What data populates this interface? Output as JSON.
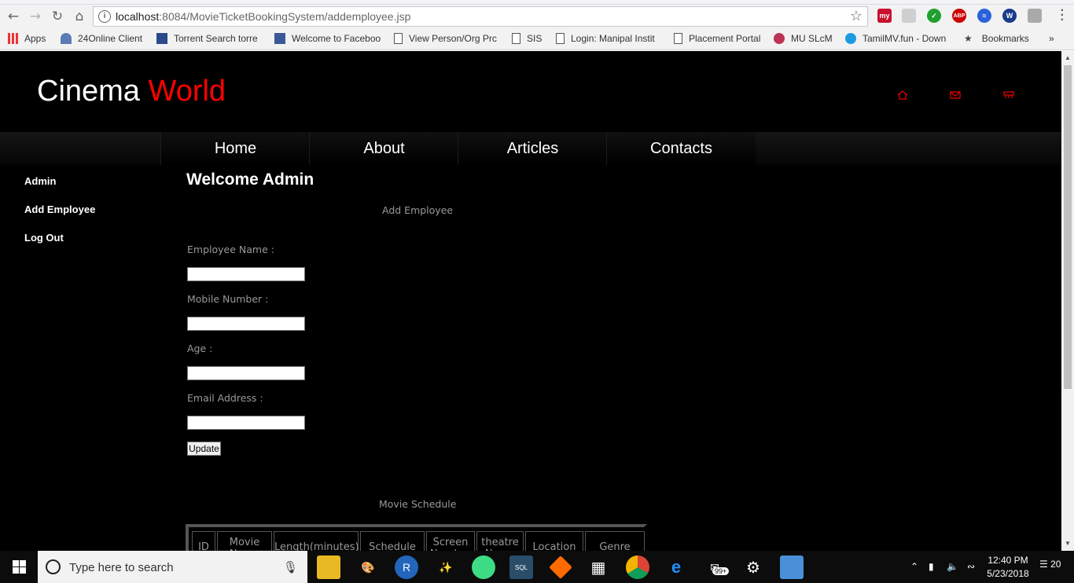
{
  "browser": {
    "url_host": "localhost",
    "url_path": ":8084/MovieTicketBookingSystem/addemployee.jsp",
    "bookmarks": [
      {
        "label": "Apps"
      },
      {
        "label": "24Online Client"
      },
      {
        "label": "Torrent Search torre"
      },
      {
        "label": "Welcome to Faceboo"
      },
      {
        "label": "View Person/Org Prc"
      },
      {
        "label": "SIS"
      },
      {
        "label": "Login: Manipal Instit"
      },
      {
        "label": "Placement Portal"
      },
      {
        "label": "MU SLcM"
      },
      {
        "label": "TamilMV.fun - Down"
      },
      {
        "label": "Bookmarks"
      }
    ],
    "more_bookmarks": "»",
    "ext_my": "my",
    "ext_abp": "ABP",
    "ext_w": "W"
  },
  "site": {
    "logo_part1": "Cinema",
    "logo_part2": "World",
    "nav": [
      "Home",
      "About",
      "Articles",
      "Contacts"
    ]
  },
  "sidebar": {
    "items": [
      "Admin",
      "Add Employee",
      "Log Out"
    ]
  },
  "main": {
    "welcome": "Welcome Admin",
    "form_title": "Add Employee",
    "fields": [
      {
        "label": "Employee Name :",
        "value": ""
      },
      {
        "label": "Mobile Number :",
        "value": ""
      },
      {
        "label": "Age :",
        "value": ""
      },
      {
        "label": "Email Address :",
        "value": ""
      }
    ],
    "submit_label": "Update",
    "schedule_title": "Movie Schedule",
    "table_headers": [
      "ID",
      "Movie Name",
      "Length(minutes)",
      "Schedule",
      "Screen Number",
      "theatre Name",
      "Location",
      "Genre"
    ]
  },
  "taskbar": {
    "search_placeholder": "Type here to search",
    "mail_badge": "99+",
    "time": "12:40 PM",
    "date": "5/23/2018",
    "notifications": "20"
  },
  "colors": {
    "accent": "#ff0000",
    "page_bg": "#000000"
  }
}
